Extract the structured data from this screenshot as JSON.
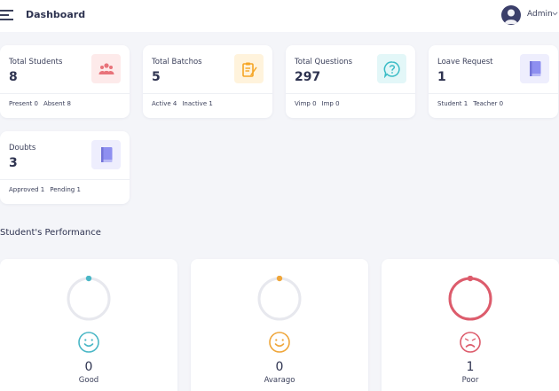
{
  "header": {
    "title": "Dashboard",
    "user_name": "Admin"
  },
  "stats": [
    {
      "label": "Total Students",
      "value": "8",
      "footer": [
        "Present 0",
        "Absent 8"
      ],
      "icon": "students-icon",
      "icon_bg": "#fdeaea",
      "icon_color": "#e8737a"
    },
    {
      "label": "Total Batchos",
      "value": "5",
      "footer": [
        "Active 4",
        "Inactive 1"
      ],
      "icon": "clipboard-pencil-icon",
      "icon_bg": "#fff3dc",
      "icon_color": "#f5a524"
    },
    {
      "label": "Total Questions",
      "value": "297",
      "footer": [
        "Vimp 0",
        "Imp 0"
      ],
      "icon": "question-bubble-icon",
      "icon_bg": "#e3f7f8",
      "icon_color": "#3bbcc6"
    },
    {
      "label": "Loave Request",
      "value": "1",
      "footer": [
        "Student 1",
        "Teacher 0"
      ],
      "icon": "book-icon",
      "icon_bg": "#eeeefd",
      "icon_color": "#8e8ff0"
    },
    {
      "label": "Doubts",
      "value": "3",
      "footer": [
        "Approved 1",
        "Pending 1"
      ],
      "icon": "book-icon",
      "icon_bg": "#eeeefd",
      "icon_color": "#8e8ff0"
    }
  ],
  "performance": {
    "title": "Student's Performance",
    "items": [
      {
        "label": "Good",
        "count": "0",
        "fraction": 0,
        "color": "#4ab7c6",
        "emoji": "smile-icon"
      },
      {
        "label": "Avarago",
        "count": "0",
        "fraction": 0,
        "color": "#efa63a",
        "emoji": "smile-icon"
      },
      {
        "label": "Poor",
        "count": "1",
        "fraction": 1,
        "color": "#dd5c6c",
        "emoji": "frown-icon"
      }
    ]
  }
}
